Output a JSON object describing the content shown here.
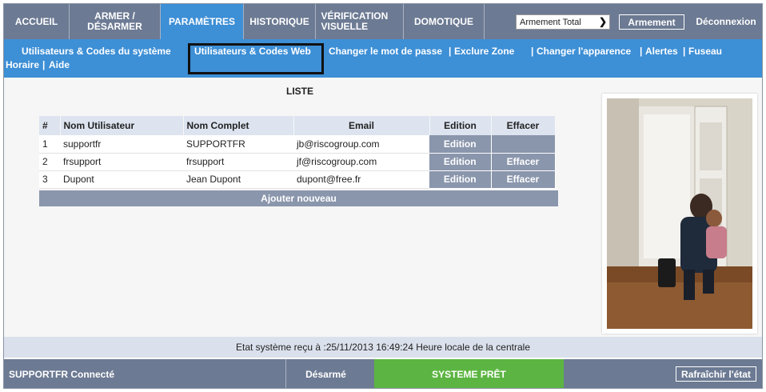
{
  "nav": {
    "home": "ACCUEIL",
    "arm_disarm": "ARMER / DÉSARMER",
    "settings": "PARAMÈTRES",
    "history": "HISTORIQUE",
    "visual_verification": "VÉRIFICATION VISUELLE",
    "home_automation": "DOMOTIQUE",
    "arm_mode_selected": "Armement Total",
    "arm_button": "Armement",
    "logout": "Déconnexion"
  },
  "subnav": {
    "system_users": "Utilisateurs & Codes du système",
    "web_users": "Utilisateurs & Codes Web",
    "change_password": "Changer le mot de passe",
    "exclude_zone": "Exclure Zone",
    "change_appearance": "Changer l'apparence",
    "alerts": "Alertes",
    "timezone_1": "Fuseau",
    "timezone_2": "Horaire",
    "help": "Aide",
    "separator": "|"
  },
  "list": {
    "title": "LISTE",
    "columns": [
      "#",
      "Nom Utilisateur",
      "Nom Complet",
      "Email",
      "Edition",
      "Effacer"
    ],
    "rows": [
      {
        "num": "1",
        "username": "supportfr",
        "fullname": "SUPPORTFR",
        "email": "jb@riscogroup.com",
        "edit": "Edition",
        "delete": ""
      },
      {
        "num": "2",
        "username": "frsupport",
        "fullname": "frsupport",
        "email": "jf@riscogroup.com",
        "edit": "Edition",
        "delete": "Effacer"
      },
      {
        "num": "3",
        "username": "Dupont",
        "fullname": "Jean Dupont",
        "email": "dupont@free.fr",
        "edit": "Edition",
        "delete": "Effacer"
      }
    ],
    "add_new": "Ajouter nouveau"
  },
  "status": {
    "line": "Etat système reçu à :25/11/2013 16:49:24 Heure locale de la centrale"
  },
  "footer": {
    "user_connected": "SUPPORTFR Connecté",
    "state": "Désarmé",
    "system_ready": "SYSTEME PRÊT",
    "refresh": "Rafraîchir l'état"
  },
  "colors": {
    "nav_bg": "#6c7a93",
    "active_blue": "#3d8fd6",
    "button_gray": "#8a96ac",
    "ready_green": "#5cb542"
  }
}
